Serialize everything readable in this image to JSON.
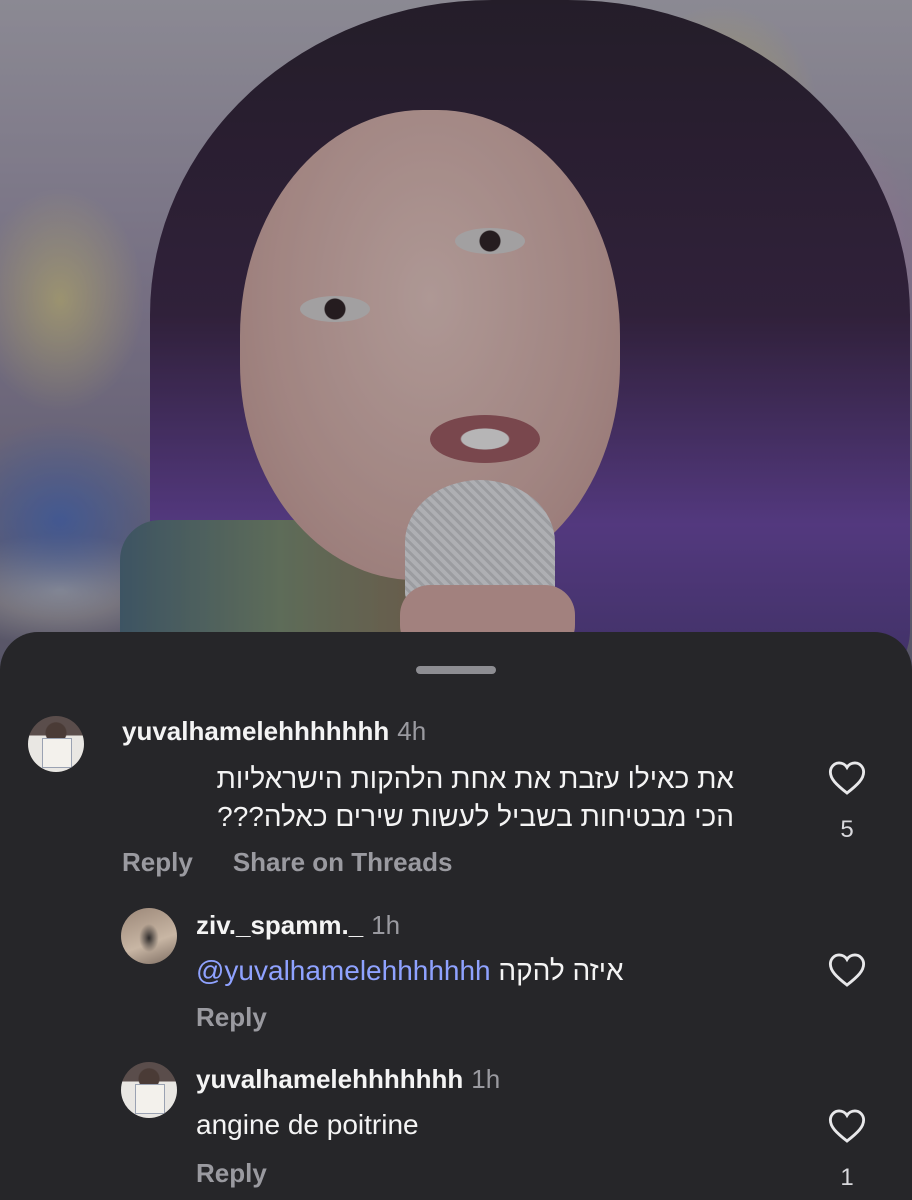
{
  "comments": [
    {
      "username": "yuvalhamelehhhhhhh",
      "time": "4h",
      "text_line1": "את כאילו עזבת את אחת הלהקות הישראליות",
      "text_line2": "הכי מבטיחות בשביל לעשות שירים כאלה???",
      "actions": {
        "reply": "Reply",
        "share": "Share on Threads"
      },
      "likes": "5",
      "heart_icon": "heart-outline-icon"
    },
    {
      "username": "ziv._spamm._",
      "time": "1h",
      "mention": "@yuvalhamelehhhhhhh",
      "text": "איזה להקה",
      "actions": {
        "reply": "Reply"
      },
      "likes": "",
      "heart_icon": "heart-outline-icon"
    },
    {
      "username": "yuvalhamelehhhhhhh",
      "time": "1h",
      "text": "angine de poitrine",
      "actions": {
        "reply": "Reply"
      },
      "likes": "1",
      "heart_icon": "heart-outline-icon"
    }
  ],
  "colors": {
    "sheet_bg": "#262629",
    "mention": "#8fa2ff",
    "muted": "#9a9aa0"
  }
}
